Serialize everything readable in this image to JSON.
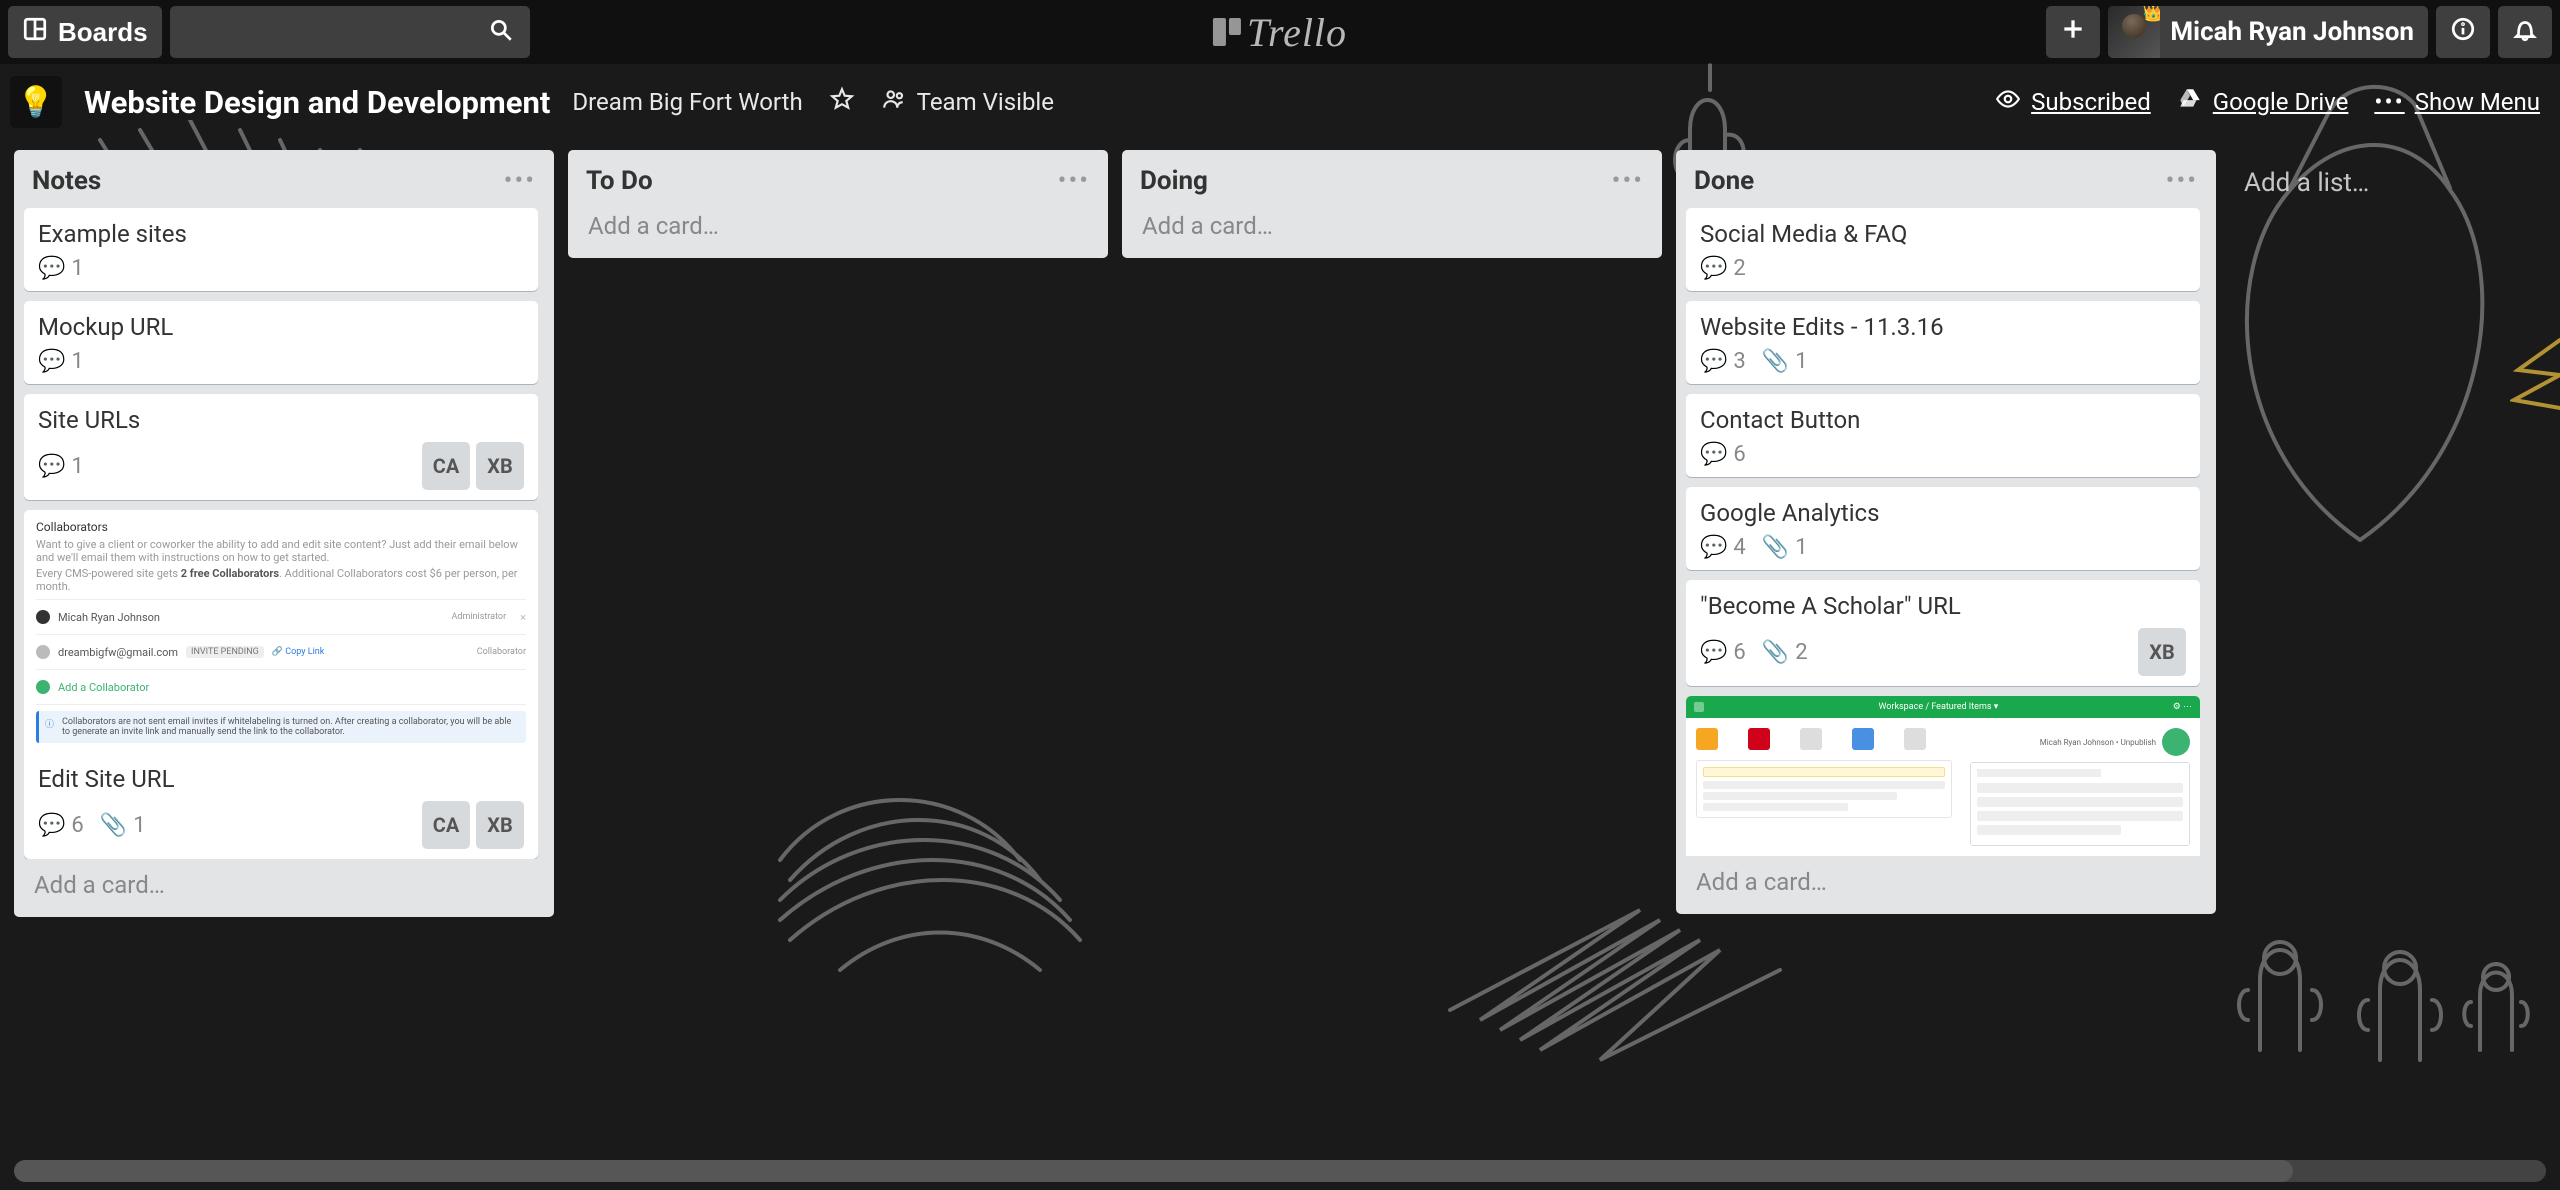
{
  "header": {
    "boards_label": "Boards",
    "brand": "Trello",
    "user_name": "Micah Ryan Johnson"
  },
  "board": {
    "title": "Website Design and Development",
    "team": "Dream Big Fort Worth",
    "visibility": "Team Visible",
    "subscribed": "Subscribed",
    "drive": "Google Drive",
    "show_menu": "Show Menu"
  },
  "lists": [
    {
      "title": "Notes",
      "add_card": "Add a card…",
      "cards": [
        {
          "title": "Example sites",
          "comments": 1
        },
        {
          "title": "Mockup URL",
          "comments": 1
        },
        {
          "title": "Site URLs",
          "comments": 1,
          "members": [
            "CA",
            "XB"
          ]
        },
        {
          "title": "Edit Site URL",
          "comments": 6,
          "attachments": 1,
          "members": [
            "CA",
            "XB"
          ],
          "cover": "collaborators"
        }
      ]
    },
    {
      "title": "To Do",
      "add_card": "Add a card…",
      "cards": []
    },
    {
      "title": "Doing",
      "add_card": "Add a card…",
      "cards": []
    },
    {
      "title": "Done",
      "add_card": "Add a card…",
      "cards": [
        {
          "title": "Social Media & FAQ",
          "comments": 2
        },
        {
          "title": "Website Edits - 11.3.16",
          "comments": 3,
          "attachments": 1
        },
        {
          "title": "Contact Button",
          "comments": 6
        },
        {
          "title": "Google Analytics",
          "comments": 4,
          "attachments": 1
        },
        {
          "title": "\"Become A Scholar\" URL",
          "comments": 6,
          "attachments": 2,
          "members": [
            "XB"
          ]
        },
        {
          "cover": "green-app"
        }
      ]
    }
  ],
  "add_list": "Add a list…"
}
